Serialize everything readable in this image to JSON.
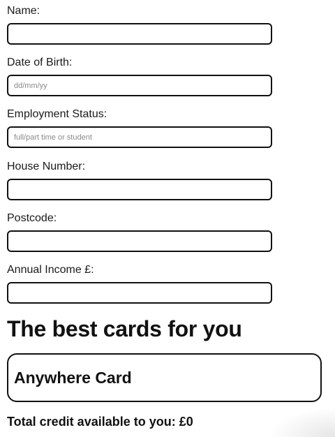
{
  "form": {
    "fields": [
      {
        "label": "Name:",
        "value": "",
        "placeholder": ""
      },
      {
        "label": "Date of Birth:",
        "value": "",
        "placeholder": "dd/mm/yy"
      },
      {
        "label": "Employment Status:",
        "value": "",
        "placeholder": "full/part time or student"
      },
      {
        "label": "House Number:",
        "value": "",
        "placeholder": ""
      },
      {
        "label": "Postcode:",
        "value": "",
        "placeholder": ""
      },
      {
        "label": "Annual Income £:",
        "value": "",
        "placeholder": ""
      }
    ]
  },
  "results": {
    "title": "The best cards for you",
    "cards": [
      {
        "name": "Anywhere Card"
      }
    ],
    "total_credit": "Total credit available to you: £0"
  }
}
